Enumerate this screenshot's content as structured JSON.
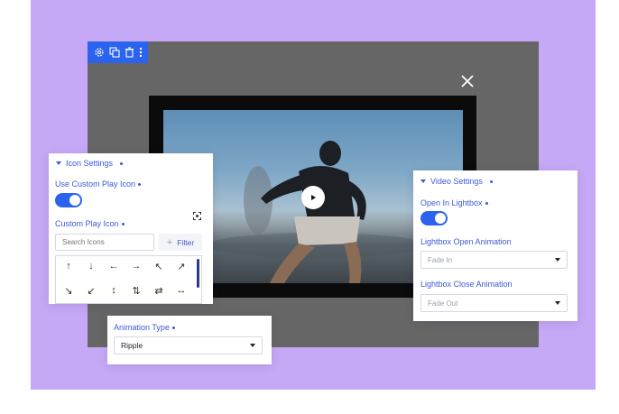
{
  "colors": {
    "accent": "#2b63ee",
    "background": "#c5a8f6",
    "lightbox": "#666666"
  },
  "icons": [
    "gear-icon",
    "duplicate-icon",
    "trash-icon",
    "more-vertical-icon",
    "close-icon",
    "play-icon",
    "focus-icon",
    "plus-icon",
    "chevron-down-icon"
  ],
  "icon_settings": {
    "title": "Icon Settings",
    "use_custom_label": "Use Custom Play Icon",
    "use_custom_on": true,
    "custom_icon_label": "Custom Play Icon",
    "search_placeholder": "Search Icons",
    "filter_label": "Filter",
    "icons": [
      "↑",
      "↓",
      "←",
      "→",
      "↖",
      "↗",
      "↘",
      "↙",
      "↕",
      "⇅",
      "⇄",
      "↔"
    ]
  },
  "animation": {
    "label": "Animation Type",
    "value": "Ripple"
  },
  "video_settings": {
    "title": "Video Settings",
    "open_lightbox_label": "Open In Lightbox",
    "open_lightbox_on": true,
    "open_anim_label": "Lightbox Open Animation",
    "open_anim_value": "Fade In",
    "close_anim_label": "Lightbox Close Animation",
    "close_anim_value": "Fade Out"
  }
}
